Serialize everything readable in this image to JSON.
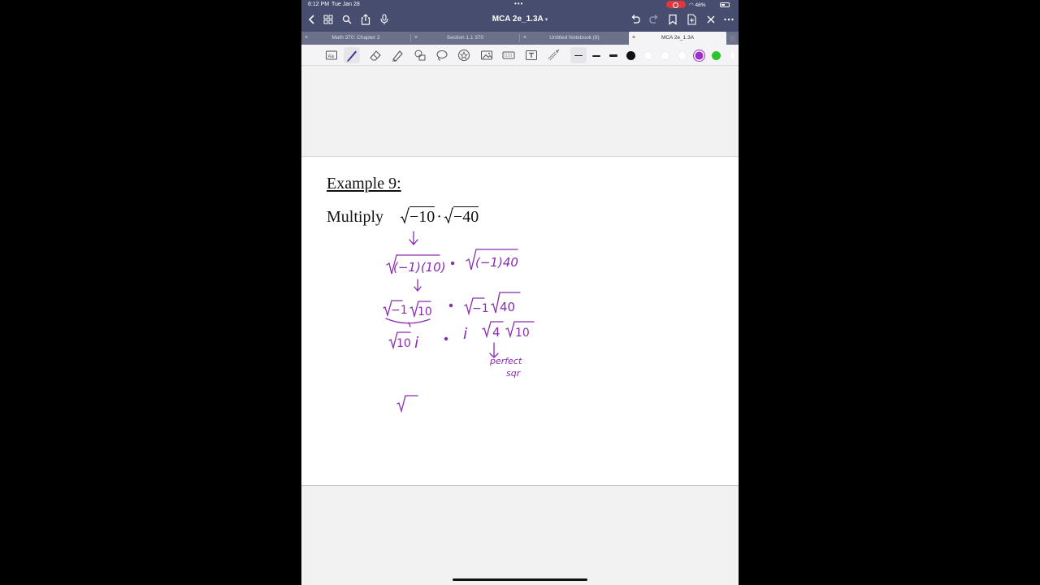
{
  "status": {
    "time": "6:12 PM",
    "date": "Tue Jan 28",
    "battery": "48%"
  },
  "nav": {
    "title": "MCA 2e_1.3A",
    "icons": [
      "back-icon",
      "grid-icon",
      "search-icon",
      "share-icon",
      "microphone-icon",
      "undo-icon",
      "redo-icon",
      "bookmark-icon",
      "add-page-icon",
      "close-icon",
      "more-icon"
    ]
  },
  "tabs": [
    {
      "label": "Math 370: Chapter 2",
      "active": false
    },
    {
      "label": "Section 1.1 370",
      "active": false
    },
    {
      "label": "Untitled Notebook (9)",
      "active": false
    },
    {
      "label": "MCA 2e_1.3A",
      "active": true
    }
  ],
  "toolbar": {
    "tools": [
      "text-recognition-icon",
      "pen-icon",
      "eraser-icon",
      "highlighter-icon",
      "shapes-icon",
      "lasso-icon",
      "sticker-icon",
      "image-icon",
      "keyboard-icon",
      "textbox-icon",
      "laser-pointer-icon"
    ],
    "colors": [
      "#111111",
      "#ffffff",
      "#ffffff",
      "#ffffff",
      "#9b2fc9",
      "#2dc52d"
    ],
    "selected_color": "#9b2fc9",
    "ink_color": "#8a2bb0"
  },
  "page": {
    "heading": "Example 9:",
    "problem_word": "Multiply",
    "radicand_1": "−10",
    "radicand_2": "−40",
    "handwriting": {
      "step1_left": "√(−1)(10)",
      "step1_right": "√(−1)40",
      "step2_left": "√−1 √10",
      "step2_right": "√−1 √40",
      "step3_left": "√10 i",
      "step3_right": "i √4 √10",
      "note_line1": "perfect",
      "note_line2": "sqr"
    }
  }
}
